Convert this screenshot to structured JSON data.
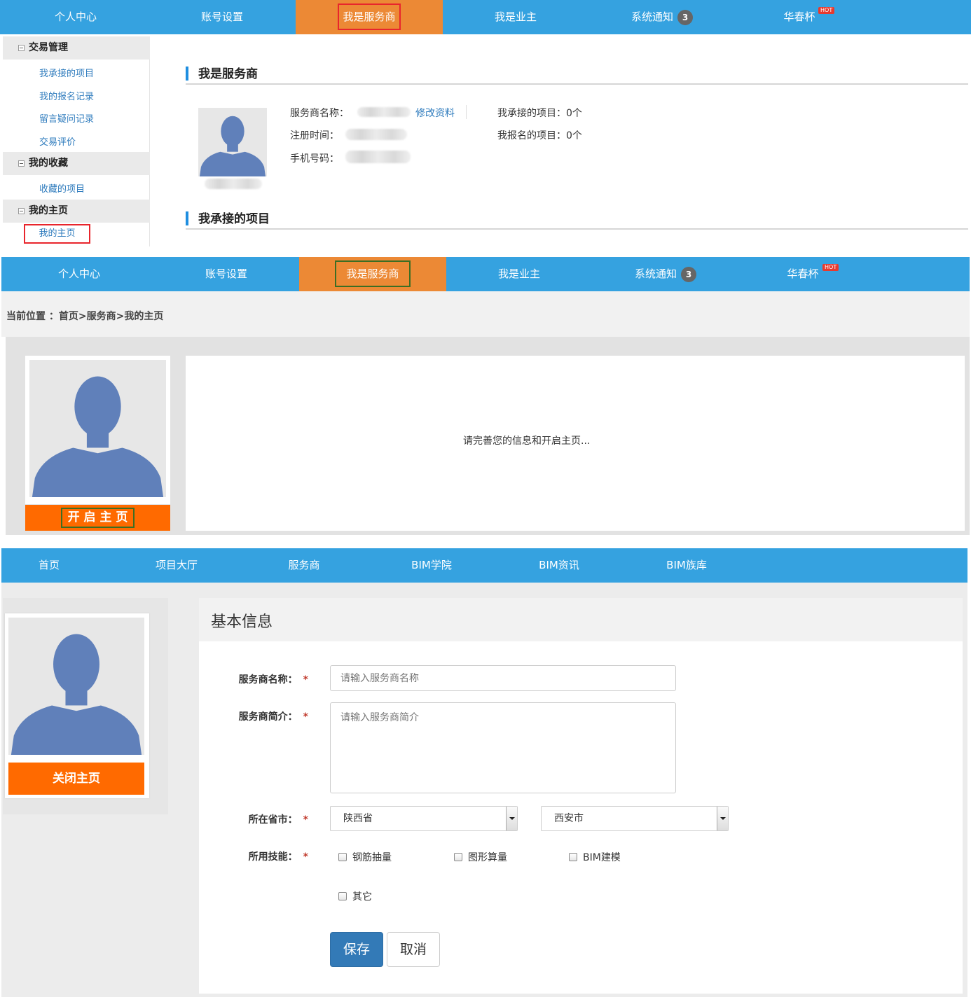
{
  "nav1": {
    "items": [
      "个人中心",
      "账号设置",
      "我是服务商",
      "我是业主",
      "系统通知",
      "华春杯"
    ],
    "badge": "3",
    "hot": "HOT"
  },
  "sidebar": {
    "groups": [
      {
        "title": "交易管理",
        "links": [
          "我承接的项目",
          "我的报名记录",
          "留言疑问记录",
          "交易评价"
        ]
      },
      {
        "title": "我的收藏",
        "links": [
          "收藏的项目"
        ]
      },
      {
        "title": "我的主页",
        "links": [
          "我的主页"
        ]
      }
    ]
  },
  "section1": {
    "title": "我是服务商",
    "name_label": "服务商名称：",
    "edit_link": "修改资料",
    "reg_label": "注册时间：",
    "phone_label": "手机号码：",
    "accepted_label": "我承接的项目：0个",
    "signed_label": "我报名的项目：0个",
    "projects_title": "我承接的项目"
  },
  "section2": {
    "breadcrumb": "当前位置 ：首页>服务商>我的主页",
    "open_button": "开 启 主 页",
    "message": "请完善您的信息和开启主页..."
  },
  "nav3": {
    "items": [
      "首页",
      "项目大厅",
      "服务商",
      "BIM学院",
      "BIM资讯",
      "BIM族库"
    ]
  },
  "section3": {
    "close_button": "关闭主页",
    "form_title": "基本信息",
    "name_label": "服务商名称：",
    "name_placeholder": "请输入服务商名称",
    "intro_label": "服务商简介：",
    "intro_placeholder": "请输入服务商简介",
    "region_label": "所在省市：",
    "province": "陕西省",
    "city": "西安市",
    "skills_label": "所用技能：",
    "skills": [
      "钢筋抽量",
      "图形算量",
      "BIM建模",
      "其它"
    ],
    "required_mark": "*",
    "save": "保存",
    "cancel": "取消"
  },
  "colors": {
    "nav_blue": "#35a2e0",
    "nav_active": "#ec8935",
    "orange_button": "#ff6a00",
    "primary_button": "#337ab7",
    "link": "#2e7bbd"
  }
}
